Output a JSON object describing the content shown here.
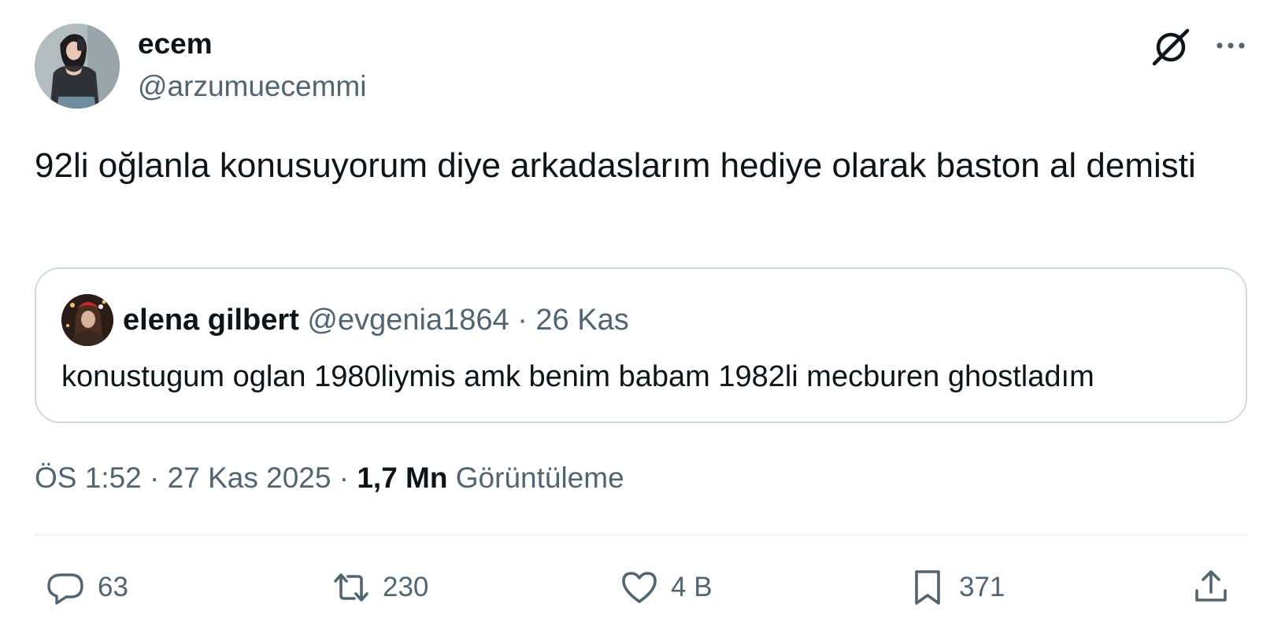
{
  "author": {
    "display_name": "ecem",
    "handle": "@arzumuecemmi"
  },
  "tweet": {
    "text": "92li oğlanla konusuyorum diye arkadaslarım hediye olarak baston al demisti"
  },
  "quoted_tweet": {
    "display_name": "elena gilbert",
    "handle": "@evgenia1864",
    "separator": "·",
    "date": "26 Kas",
    "text": "konustugum oglan 1980liymis amk benim babam 1982li mecburen ghostladım"
  },
  "meta": {
    "time": "ÖS 1:52",
    "separator": "·",
    "date": "27 Kas 2025",
    "views_count": "1,7 Mn",
    "views_label": "Görüntüleme"
  },
  "actions": {
    "replies": "63",
    "reposts": "230",
    "likes": "4 B",
    "bookmarks": "371"
  },
  "icons": {
    "grok": "grok-icon",
    "more": "more-icon",
    "reply": "reply-icon",
    "repost": "repost-icon",
    "like": "heart-icon",
    "bookmark": "bookmark-icon",
    "share": "share-icon"
  },
  "colors": {
    "text_primary": "#0f1419",
    "text_secondary": "#536471",
    "border": "#cfd9de",
    "divider": "#eff3f4",
    "background": "#ffffff"
  }
}
